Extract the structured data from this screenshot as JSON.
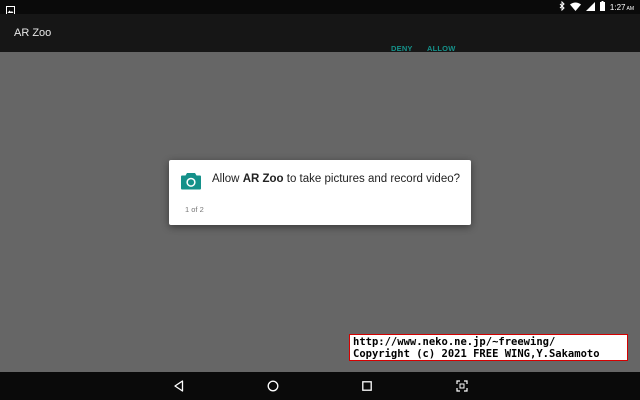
{
  "status_bar": {
    "time": "1:27",
    "ampm": "AM",
    "icons": [
      "image-icon",
      "bluetooth-icon",
      "wifi-icon",
      "signal-icon",
      "battery-icon"
    ]
  },
  "app_bar": {
    "title": "AR Zoo"
  },
  "dialog": {
    "icon": "camera-icon",
    "message_prefix": "Allow ",
    "app_name": "AR Zoo",
    "message_suffix": " to take pictures and record video?",
    "counter": "1 of 2",
    "deny_label": "DENY",
    "allow_label": "ALLOW"
  },
  "watermark": {
    "line1": "http://www.neko.ne.jp/~freewing/",
    "line2": "Copyright (c) 2021 FREE WING,Y.Sakamoto"
  },
  "nav_bar": {
    "buttons": [
      "back-icon",
      "home-icon",
      "recents-icon",
      "screenshot-icon"
    ]
  },
  "colors": {
    "accent": "#15918a",
    "scrim": "#666666",
    "app_bar": "#161616",
    "status_bar": "#0a0a0a"
  }
}
